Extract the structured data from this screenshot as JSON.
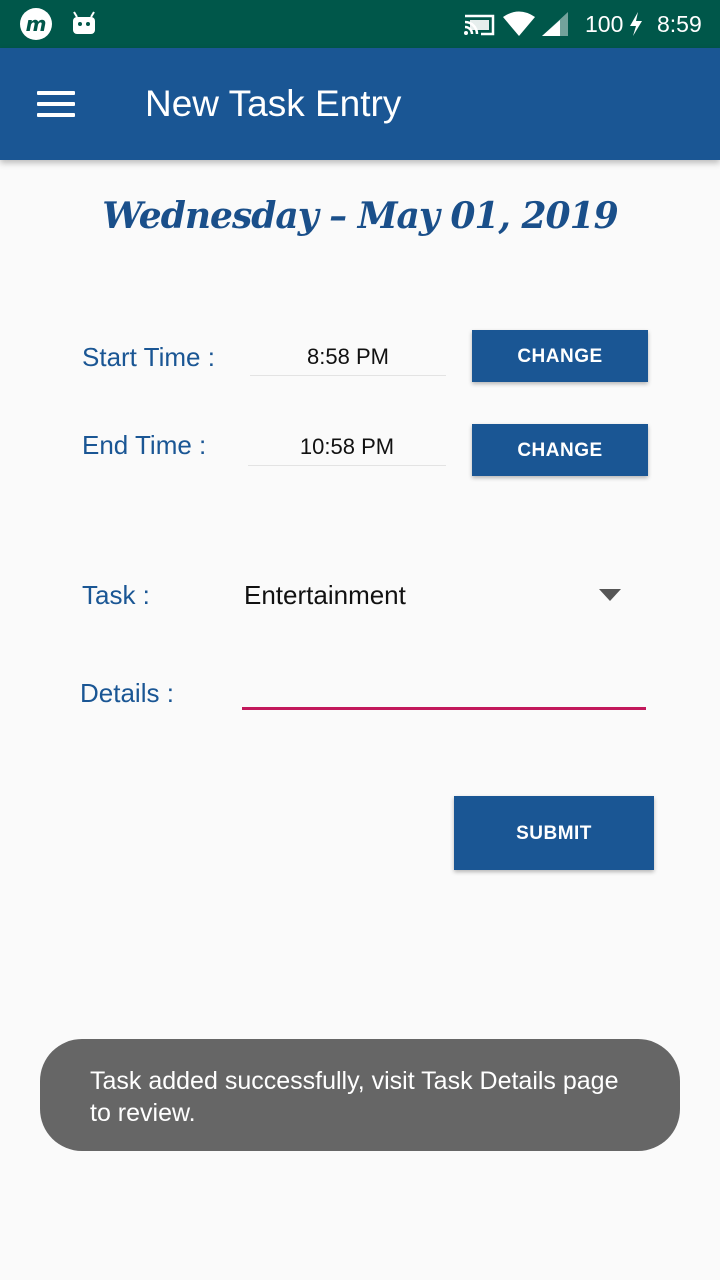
{
  "status_bar": {
    "app_icon_letter": "m",
    "battery": "100",
    "time": "8:59"
  },
  "app_bar": {
    "title": "New Task Entry"
  },
  "date_heading": "Wednesday – May 01, 2019",
  "form": {
    "start_time_label": "Start Time :",
    "start_time_value": "8:58 PM",
    "end_time_label": "End Time :",
    "end_time_value": "10:58 PM",
    "change_label": "CHANGE",
    "task_label": "Task :",
    "task_value": "Entertainment",
    "details_label": "Details :",
    "details_value": "",
    "submit_label": "SUBMIT"
  },
  "toast": {
    "message": "Task added successfully, visit Task Details page to review."
  },
  "colors": {
    "status_bar": "#00574a",
    "primary": "#1a5694",
    "accent": "#c2185b",
    "toast_bg": "#666666"
  },
  "icons": [
    "app-m-icon",
    "android-icon",
    "cast-icon",
    "wifi-icon",
    "signal-icon",
    "charging-icon",
    "menu-icon",
    "dropdown-arrow-icon"
  ]
}
